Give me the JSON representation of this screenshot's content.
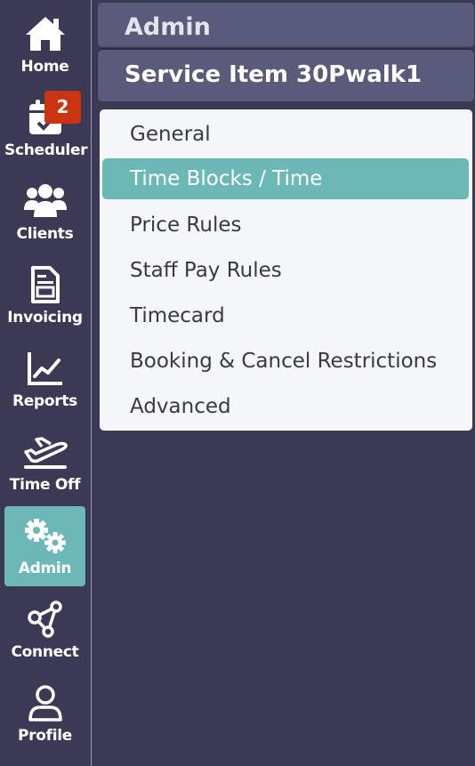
{
  "nav": {
    "items": [
      {
        "label": "Home",
        "icon": "home-icon"
      },
      {
        "label": "Scheduler",
        "icon": "calendar-check-icon"
      },
      {
        "label": "Clients",
        "icon": "users-icon"
      },
      {
        "label": "Invoicing",
        "icon": "invoice-icon"
      },
      {
        "label": "Reports",
        "icon": "chart-line-icon"
      },
      {
        "label": "Time Off",
        "icon": "plane-departure-icon"
      },
      {
        "label": "Admin",
        "icon": "cogs-icon"
      },
      {
        "label": "Connect",
        "icon": "share-nodes-icon"
      },
      {
        "label": "Profile",
        "icon": "user-icon"
      }
    ],
    "active": "Admin",
    "scheduler_badge": "2"
  },
  "header": {
    "section": "Admin",
    "title": "Service Item 30Pwalk1"
  },
  "menu": {
    "items": [
      {
        "label": "General"
      },
      {
        "label": "Time Blocks / Time"
      },
      {
        "label": "Price Rules"
      },
      {
        "label": "Staff Pay Rules"
      },
      {
        "label": "Timecard"
      },
      {
        "label": "Booking & Cancel Restrictions"
      },
      {
        "label": "Advanced"
      }
    ],
    "active": "Time Blocks / Time"
  },
  "colors": {
    "background": "#3a3a55",
    "accent": "#6cb8b6",
    "header": "#5a5a7a",
    "badge": "#cc3311",
    "panel": "#f3f7fa"
  }
}
